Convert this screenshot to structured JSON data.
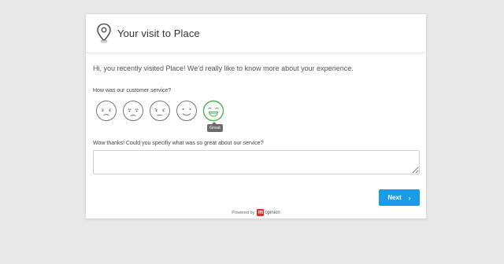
{
  "header": {
    "title": "Your visit to Place",
    "icon": "map-pin-icon"
  },
  "intro": "Hi, you recently visited Place! We'd really like to know more about your experience.",
  "question1": "How was our customer service?",
  "rating": {
    "options": [
      "very-bad",
      "bad",
      "neutral",
      "good",
      "great"
    ],
    "selected": "great",
    "tooltip": "Great",
    "selected_color": "#4caf50"
  },
  "question2": "Wow thanks! Could you specifiy what was so great about our service?",
  "answer": {
    "value": ""
  },
  "next_button": {
    "label": "Next",
    "chevron": "›",
    "color": "#1a9be6"
  },
  "footer": {
    "powered_by": "Powered by",
    "logo_letter": "m",
    "brand": "opinion",
    "logo_color": "#d9322f"
  }
}
